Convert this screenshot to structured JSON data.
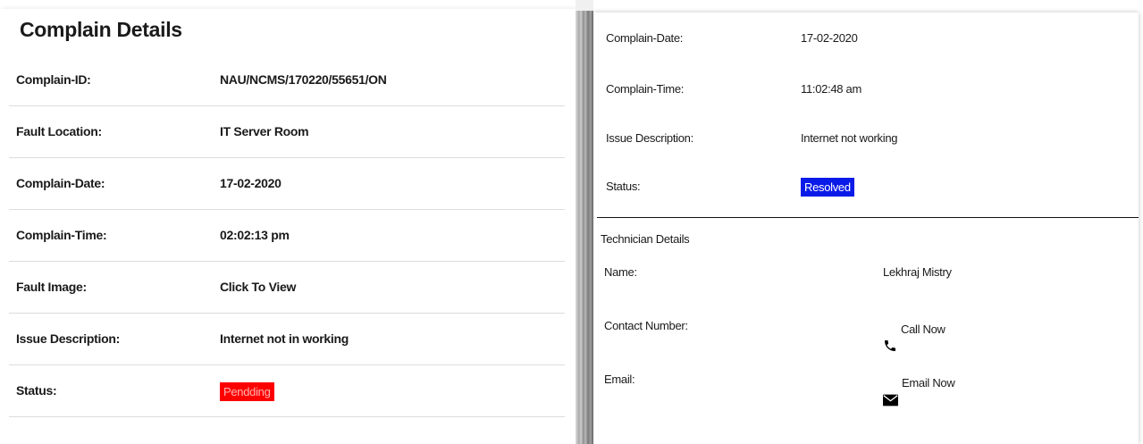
{
  "complain_details": {
    "title": "Complain Details",
    "rows": [
      {
        "label": "Complain-ID:",
        "value": "NAU/NCMS/170220/55651/ON"
      },
      {
        "label": "Fault Location:",
        "value": "IT Server Room"
      },
      {
        "label": "Complain-Date:",
        "value": "17-02-2020"
      },
      {
        "label": "Complain-Time:",
        "value": "02:02:13 pm"
      },
      {
        "label": "Fault Image:",
        "value": "Click To View"
      },
      {
        "label": "Issue Description:",
        "value": "Internet not in working"
      },
      {
        "label": "Status:",
        "value": "Pendding"
      }
    ],
    "status_color": "#ff0000"
  },
  "second_complaint": {
    "rows": [
      {
        "label": "Complain-Date:",
        "value": "17-02-2020"
      },
      {
        "label": "Complain-Time:",
        "value": "11:02:48 am"
      },
      {
        "label": "Issue Description:",
        "value": "Internet not working"
      },
      {
        "label": "Status:",
        "value": "Resolved"
      }
    ],
    "status_color": "#0a1be8"
  },
  "technician": {
    "heading": "Technician Details",
    "name_label": "Name:",
    "name_value": "Lekhraj Mistry",
    "contact_label": "Contact Number:",
    "contact_action": "Call Now",
    "contact_icon": "phone-icon",
    "email_label": "Email:",
    "email_action": "Email Now",
    "email_icon": "envelope-icon"
  }
}
